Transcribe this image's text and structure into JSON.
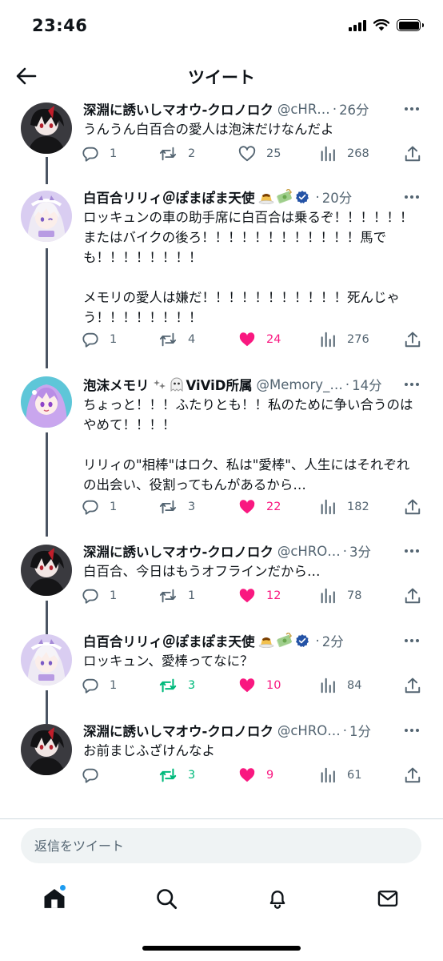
{
  "status": {
    "time": "23:46"
  },
  "header": {
    "title": "ツイート"
  },
  "colors": {
    "like": "#f91880",
    "retweet": "#00ba7c",
    "verified": "#2453a6",
    "accent": "#1d9bf0",
    "muted": "#536471"
  },
  "tweets": [
    {
      "name": "深淵に誘いしマオウ-クロノロク",
      "handle": "@cHR…",
      "time": "26分",
      "text": "うんうん白百合の愛人は泡沫だけなんだよ",
      "replies": "1",
      "retweets": "2",
      "likes": "25",
      "views": "268",
      "liked": false,
      "retweeted": false,
      "avatar": "dark"
    },
    {
      "name": "白百合リリィ＠ぽまぽま天使",
      "handle": "",
      "time": "20分",
      "text": "ロッキュンの車の助手席に白百合は乗るぞ！！！！！！またはバイクの後ろ！！！！！！！！！！！！馬でも！！！！！！！！\n\nメモリの愛人は嫌だ！！！！！！！！！！！死んじゃう！！！！！！！！",
      "replies": "1",
      "retweets": "4",
      "likes": "24",
      "views": "276",
      "liked": true,
      "retweeted": false,
      "avatar": "lily",
      "badges": [
        "pudding-emoji",
        "money-emoji",
        "verified-badge"
      ]
    },
    {
      "name": "泡沫メモリ",
      "name_suffix": "ViViD所属",
      "handle": "@Memory_…",
      "time": "14分",
      "text": "ちょっと！！！ふたりとも！！私のために争い合うのはやめて！！！！\n\nリリィの\"相棒\"はロク、私は\"愛棒\"、人生にはそれぞれの出会い、役割ってもんがあるから…",
      "replies": "1",
      "retweets": "3",
      "likes": "22",
      "views": "182",
      "liked": true,
      "retweeted": false,
      "avatar": "memory",
      "badges": [
        "stars-emoji",
        "ghost-emoji"
      ]
    },
    {
      "name": "深淵に誘いしマオウ-クロノロク",
      "handle": "@cHRO…",
      "time": "3分",
      "text": "白百合、今日はもうオフラインだから…",
      "replies": "1",
      "retweets": "1",
      "likes": "12",
      "views": "78",
      "liked": true,
      "retweeted": false,
      "avatar": "dark"
    },
    {
      "name": "白百合リリィ＠ぽまぽま天使",
      "handle": "",
      "time": "2分",
      "text": "ロッキュン、愛棒ってなに？",
      "replies": "1",
      "retweets": "3",
      "likes": "10",
      "views": "84",
      "liked": true,
      "retweeted": true,
      "avatar": "lily",
      "badges": [
        "pudding-emoji",
        "money-emoji",
        "verified-badge"
      ]
    },
    {
      "name": "深淵に誘いしマオウ-クロノロク",
      "handle": "@cHRO…",
      "time": "1分",
      "text": "お前まじふざけんなよ",
      "replies": "",
      "retweets": "3",
      "likes": "9",
      "views": "61",
      "liked": true,
      "retweeted": true,
      "avatar": "dark"
    }
  ],
  "reply": {
    "placeholder": "返信をツイート"
  },
  "nav": [
    "home-icon",
    "search-icon",
    "notifications-icon",
    "messages-icon"
  ]
}
